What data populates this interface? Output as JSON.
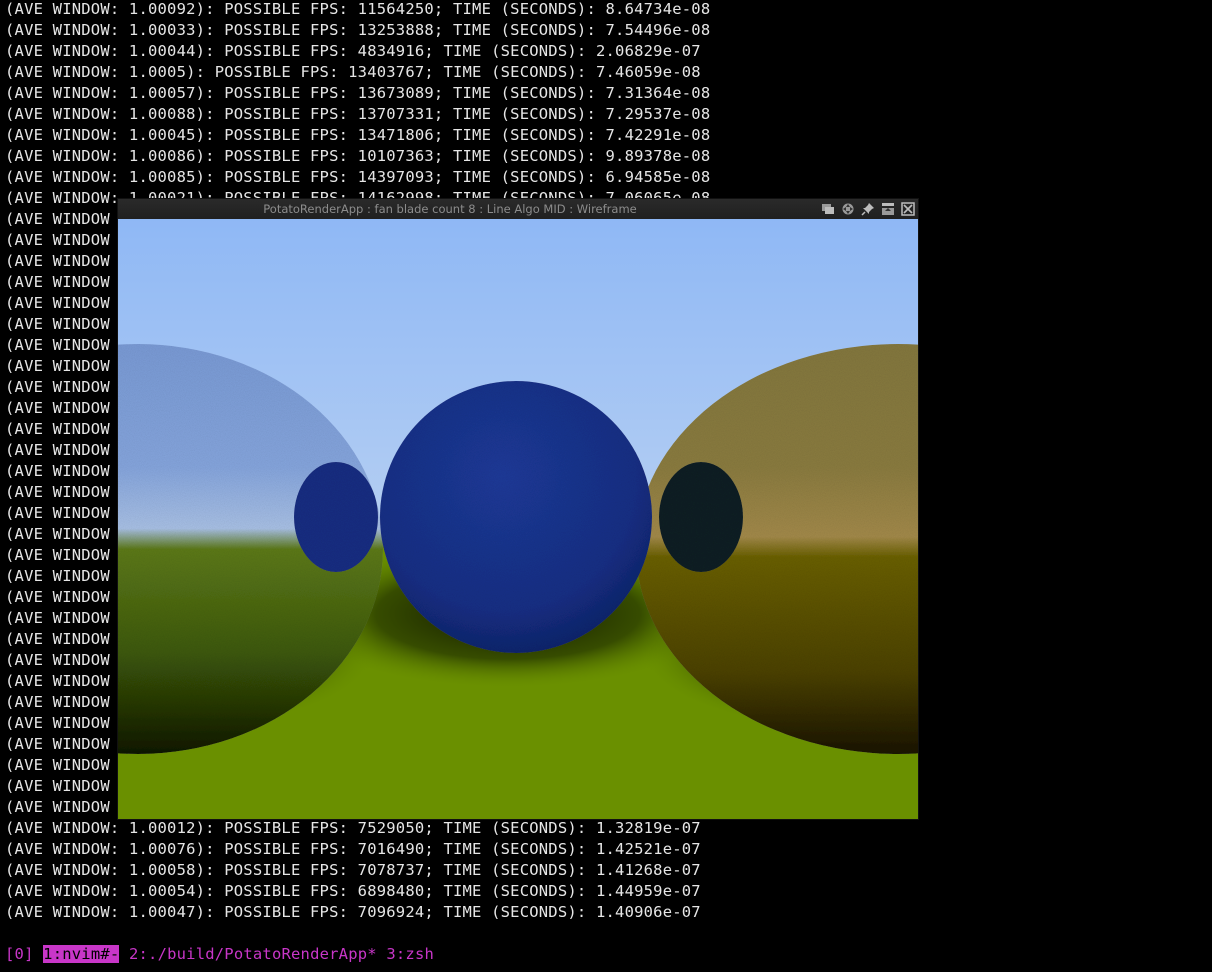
{
  "terminal": {
    "lines_top": [
      "(AVE WINDOW: 1.00092): POSSIBLE FPS: 11564250; TIME (SECONDS): 8.64734e-08",
      "(AVE WINDOW: 1.00033): POSSIBLE FPS: 13253888; TIME (SECONDS): 7.54496e-08",
      "(AVE WINDOW: 1.00044): POSSIBLE FPS: 4834916; TIME (SECONDS): 2.06829e-07",
      "(AVE WINDOW: 1.0005): POSSIBLE FPS: 13403767; TIME (SECONDS): 7.46059e-08",
      "(AVE WINDOW: 1.00057): POSSIBLE FPS: 13673089; TIME (SECONDS): 7.31364e-08",
      "(AVE WINDOW: 1.00088): POSSIBLE FPS: 13707331; TIME (SECONDS): 7.29537e-08",
      "(AVE WINDOW: 1.00045): POSSIBLE FPS: 13471806; TIME (SECONDS): 7.42291e-08",
      "(AVE WINDOW: 1.00086): POSSIBLE FPS: 10107363; TIME (SECONDS): 9.89378e-08",
      "(AVE WINDOW: 1.00085): POSSIBLE FPS: 14397093; TIME (SECONDS): 6.94585e-08",
      "(AVE WINDOW: 1.00021): POSSIBLE FPS: 14162998; TIME (SECONDS): 7.06065e-08"
    ],
    "lines_hidden_prefix": "(AVE WINDOW",
    "hidden_count": 29,
    "lines_bottom": [
      "(AVE WINDOW: 1.00012): POSSIBLE FPS: 7529050; TIME (SECONDS): 1.32819e-07",
      "(AVE WINDOW: 1.00076): POSSIBLE FPS: 7016490; TIME (SECONDS): 1.42521e-07",
      "(AVE WINDOW: 1.00058): POSSIBLE FPS: 7078737; TIME (SECONDS): 1.41268e-07",
      "(AVE WINDOW: 1.00054): POSSIBLE FPS: 6898480; TIME (SECONDS): 1.44959e-07",
      "(AVE WINDOW: 1.00047): POSSIBLE FPS: 7096924; TIME (SECONDS): 1.40906e-07"
    ]
  },
  "render_window": {
    "title": "PotatoRenderApp : fan blade count 8 : Line Algo MID : Wireframe",
    "buttons": [
      "minimize-icon",
      "move-icon",
      "pin-icon",
      "maximize-icon",
      "close-icon"
    ],
    "colors": {
      "sky_top": "#8fb8f5",
      "sky_bottom": "#c8dcf2",
      "ground": "#6a9000",
      "center_sphere": "#17318a",
      "left_metal": "#6f8fc8",
      "right_metal": "#8a7a3a"
    }
  },
  "statusbar": {
    "session": "[0]",
    "windows": [
      {
        "label": "1:nvim#-",
        "active": true
      },
      {
        "label": "2:./build/PotatoRenderApp*",
        "active": false
      },
      {
        "label": "3:zsh",
        "active": false
      }
    ]
  }
}
